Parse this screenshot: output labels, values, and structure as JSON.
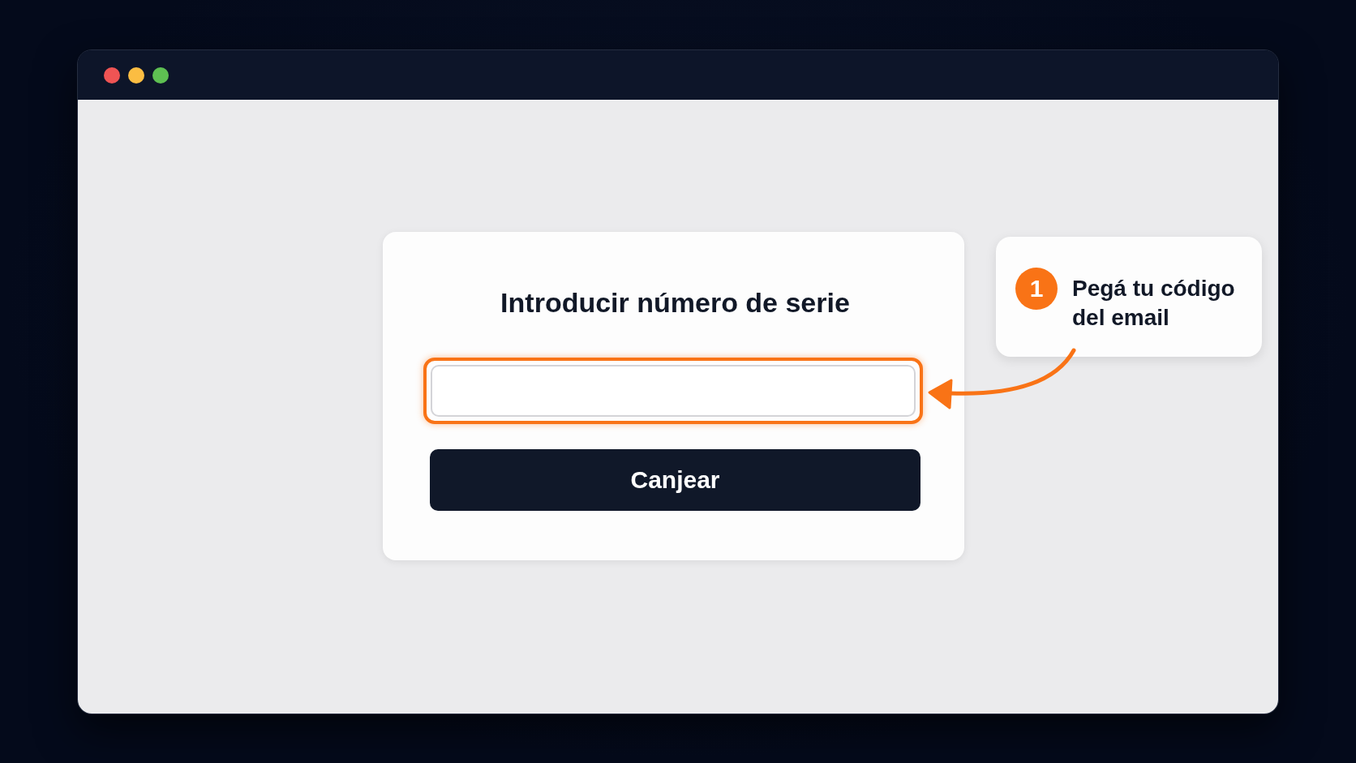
{
  "card": {
    "title": "Introducir número de serie",
    "input": {
      "highlighted": true
    },
    "button": "Canjear"
  },
  "callout": {
    "step": "1",
    "text": "Pegá tu código del email"
  }
}
